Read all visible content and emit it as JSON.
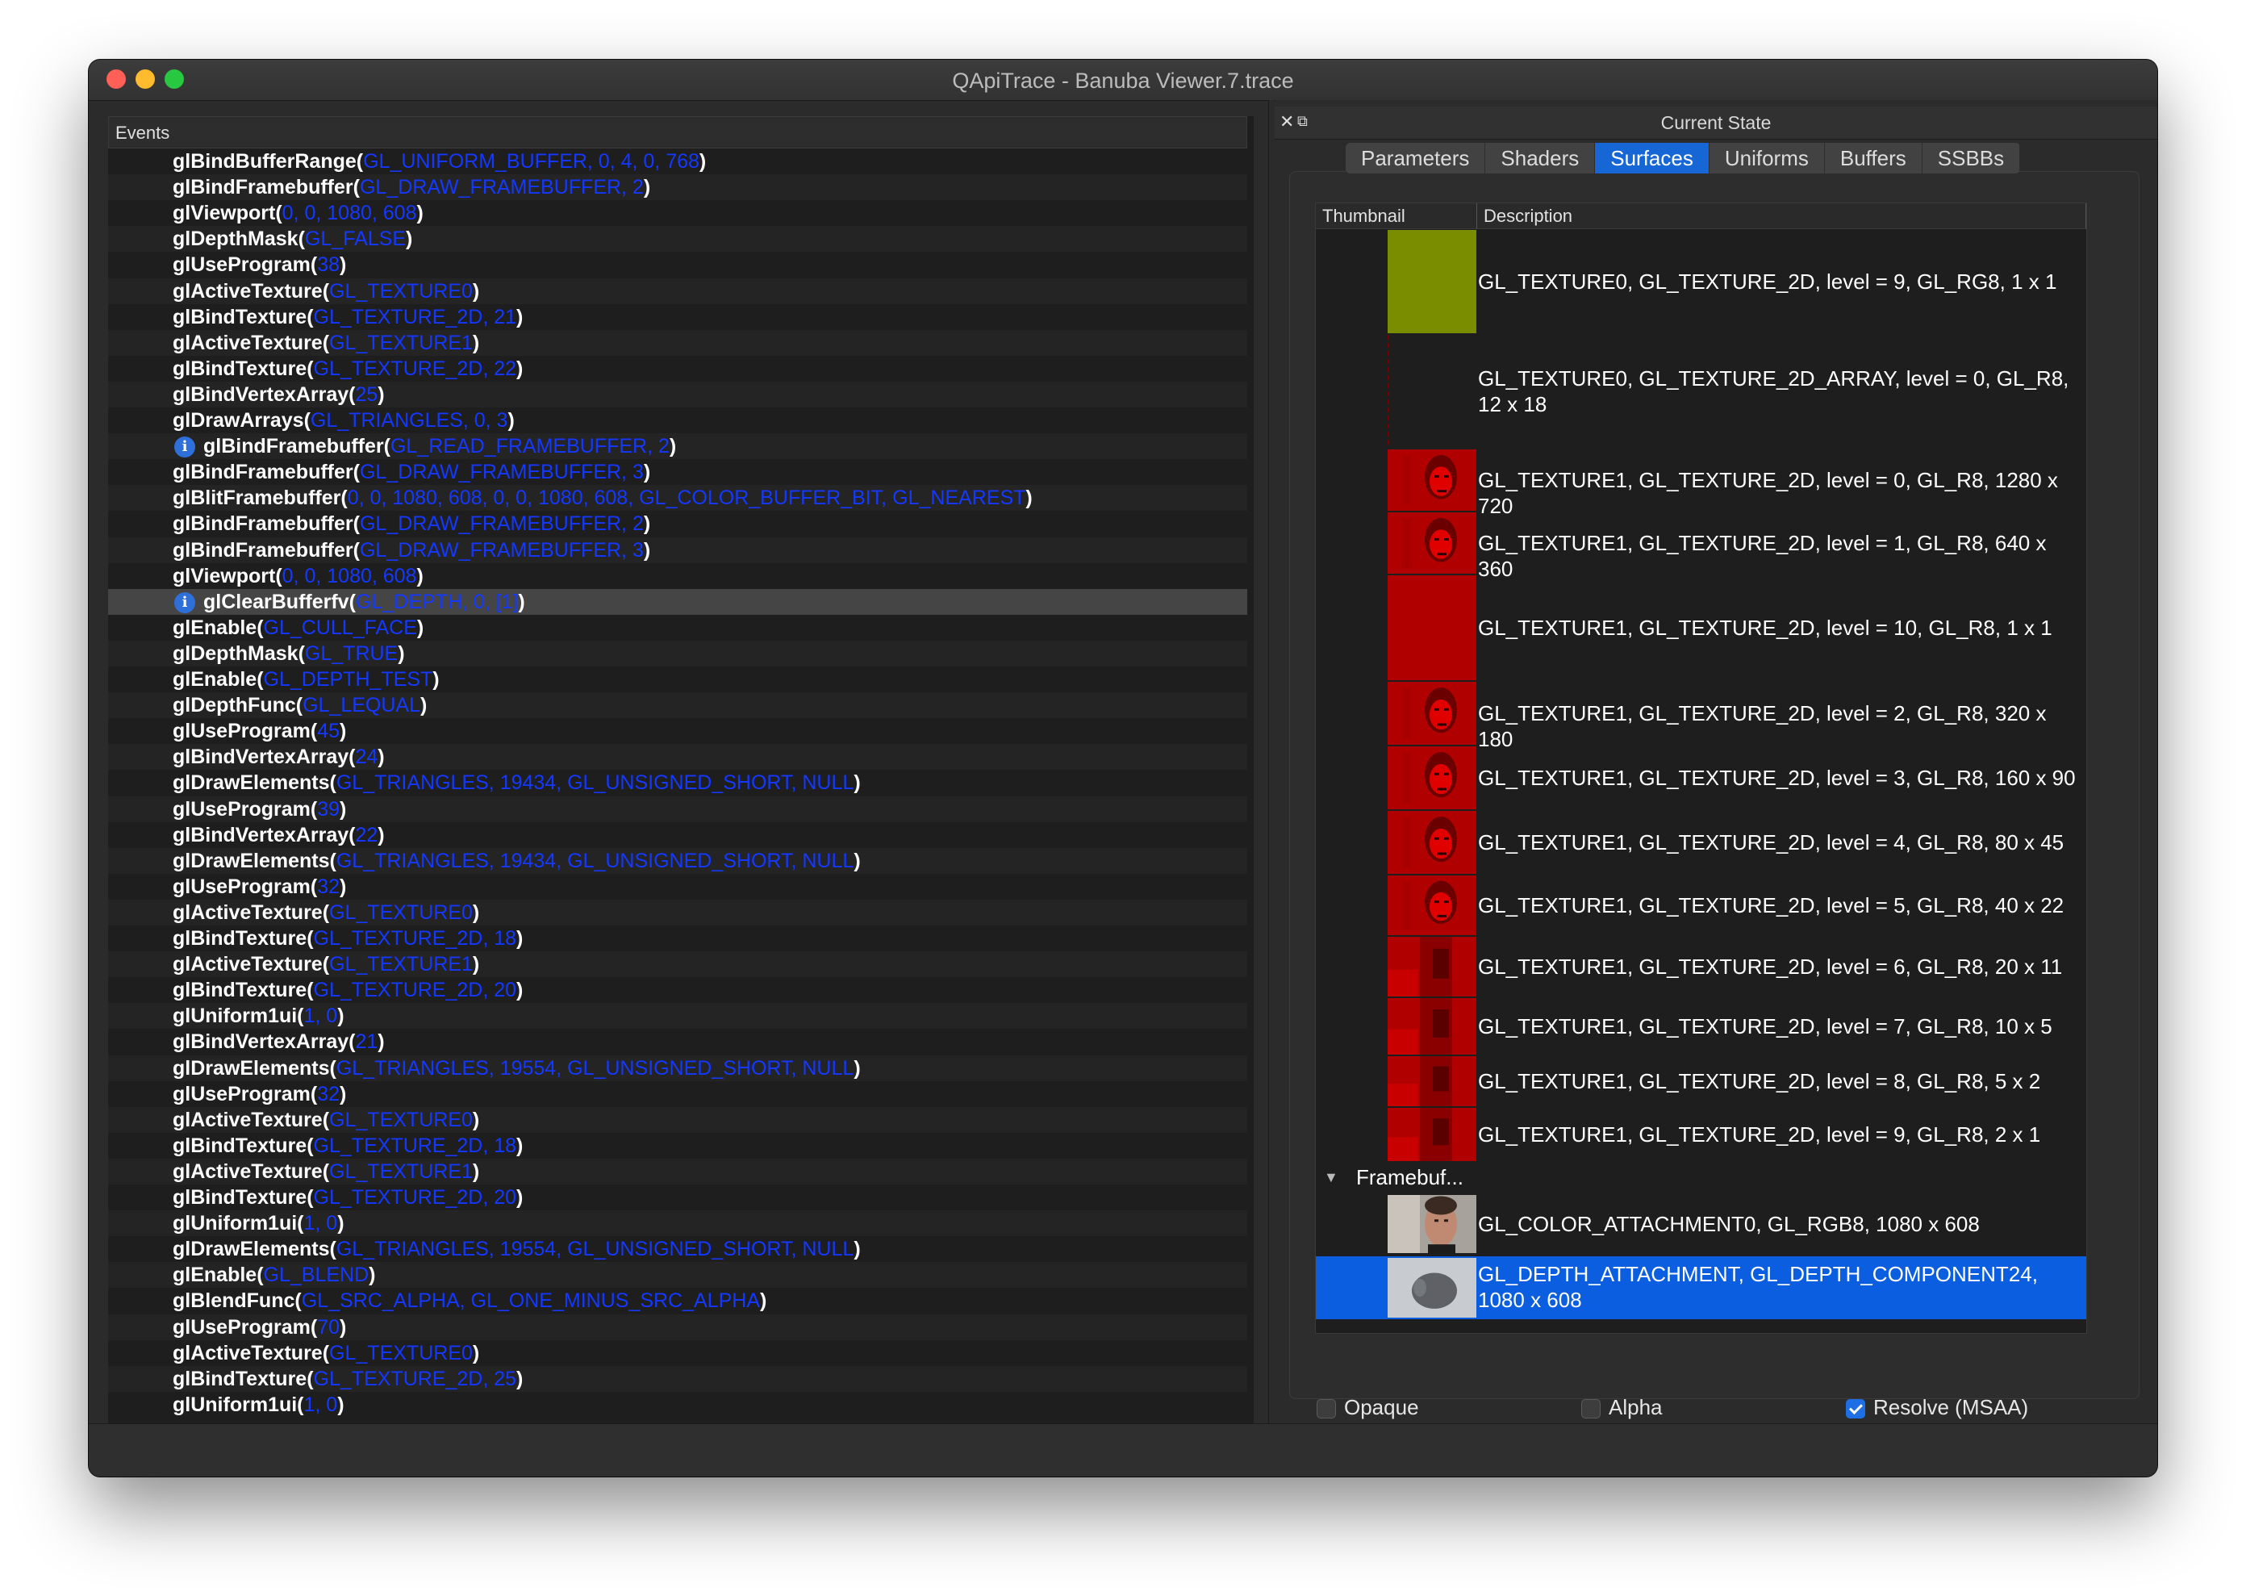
{
  "window": {
    "title": "QApiTrace - Banuba Viewer.7.trace"
  },
  "events": {
    "header": "Events",
    "rows": [
      {
        "fn": "glBindBufferRange",
        "args": "GL_UNIFORM_BUFFER, 0, 4, 0, 768",
        "info": false
      },
      {
        "fn": "glBindFramebuffer",
        "args": "GL_DRAW_FRAMEBUFFER, 2",
        "info": false
      },
      {
        "fn": "glViewport",
        "args": "0, 0, 1080, 608",
        "info": false
      },
      {
        "fn": "glDepthMask",
        "args": "GL_FALSE",
        "info": false
      },
      {
        "fn": "glUseProgram",
        "args": "38",
        "info": false
      },
      {
        "fn": "glActiveTexture",
        "args": "GL_TEXTURE0",
        "info": false
      },
      {
        "fn": "glBindTexture",
        "args": "GL_TEXTURE_2D, 21",
        "info": false
      },
      {
        "fn": "glActiveTexture",
        "args": "GL_TEXTURE1",
        "info": false
      },
      {
        "fn": "glBindTexture",
        "args": "GL_TEXTURE_2D, 22",
        "info": false
      },
      {
        "fn": "glBindVertexArray",
        "args": "25",
        "info": false
      },
      {
        "fn": "glDrawArrays",
        "args": "GL_TRIANGLES, 0, 3",
        "info": false
      },
      {
        "fn": "glBindFramebuffer",
        "args": "GL_READ_FRAMEBUFFER, 2",
        "info": true
      },
      {
        "fn": "glBindFramebuffer",
        "args": "GL_DRAW_FRAMEBUFFER, 3",
        "info": false
      },
      {
        "fn": "glBlitFramebuffer",
        "args": "0, 0, 1080, 608, 0, 0, 1080, 608, GL_COLOR_BUFFER_BIT, GL_NEAREST",
        "info": false
      },
      {
        "fn": "glBindFramebuffer",
        "args": "GL_DRAW_FRAMEBUFFER, 2",
        "info": false
      },
      {
        "fn": "glBindFramebuffer",
        "args": "GL_DRAW_FRAMEBUFFER, 3",
        "info": false
      },
      {
        "fn": "glViewport",
        "args": "0, 0, 1080, 608",
        "info": false
      },
      {
        "fn": "glClearBufferfv",
        "args": "GL_DEPTH, 0, [1]",
        "info": true,
        "selected": true
      },
      {
        "fn": "glEnable",
        "args": "GL_CULL_FACE",
        "info": false
      },
      {
        "fn": "glDepthMask",
        "args": "GL_TRUE",
        "info": false
      },
      {
        "fn": "glEnable",
        "args": "GL_DEPTH_TEST",
        "info": false
      },
      {
        "fn": "glDepthFunc",
        "args": "GL_LEQUAL",
        "info": false
      },
      {
        "fn": "glUseProgram",
        "args": "45",
        "info": false
      },
      {
        "fn": "glBindVertexArray",
        "args": "24",
        "info": false
      },
      {
        "fn": "glDrawElements",
        "args": "GL_TRIANGLES, 19434, GL_UNSIGNED_SHORT, NULL",
        "info": false
      },
      {
        "fn": "glUseProgram",
        "args": "39",
        "info": false
      },
      {
        "fn": "glBindVertexArray",
        "args": "22",
        "info": false
      },
      {
        "fn": "glDrawElements",
        "args": "GL_TRIANGLES, 19434, GL_UNSIGNED_SHORT, NULL",
        "info": false
      },
      {
        "fn": "glUseProgram",
        "args": "32",
        "info": false
      },
      {
        "fn": "glActiveTexture",
        "args": "GL_TEXTURE0",
        "info": false
      },
      {
        "fn": "glBindTexture",
        "args": "GL_TEXTURE_2D, 18",
        "info": false
      },
      {
        "fn": "glActiveTexture",
        "args": "GL_TEXTURE1",
        "info": false
      },
      {
        "fn": "glBindTexture",
        "args": "GL_TEXTURE_2D, 20",
        "info": false
      },
      {
        "fn": "glUniform1ui",
        "args": "1, 0",
        "info": false
      },
      {
        "fn": "glBindVertexArray",
        "args": "21",
        "info": false
      },
      {
        "fn": "glDrawElements",
        "args": "GL_TRIANGLES, 19554, GL_UNSIGNED_SHORT, NULL",
        "info": false
      },
      {
        "fn": "glUseProgram",
        "args": "32",
        "info": false
      },
      {
        "fn": "glActiveTexture",
        "args": "GL_TEXTURE0",
        "info": false
      },
      {
        "fn": "glBindTexture",
        "args": "GL_TEXTURE_2D, 18",
        "info": false
      },
      {
        "fn": "glActiveTexture",
        "args": "GL_TEXTURE1",
        "info": false
      },
      {
        "fn": "glBindTexture",
        "args": "GL_TEXTURE_2D, 20",
        "info": false
      },
      {
        "fn": "glUniform1ui",
        "args": "1, 0",
        "info": false
      },
      {
        "fn": "glDrawElements",
        "args": "GL_TRIANGLES, 19554, GL_UNSIGNED_SHORT, NULL",
        "info": false
      },
      {
        "fn": "glEnable",
        "args": "GL_BLEND",
        "info": false
      },
      {
        "fn": "glBlendFunc",
        "args": "GL_SRC_ALPHA, GL_ONE_MINUS_SRC_ALPHA",
        "info": false
      },
      {
        "fn": "glUseProgram",
        "args": "70",
        "info": false
      },
      {
        "fn": "glActiveTexture",
        "args": "GL_TEXTURE0",
        "info": false
      },
      {
        "fn": "glBindTexture",
        "args": "GL_TEXTURE_2D, 25",
        "info": false
      },
      {
        "fn": "glUniform1ui",
        "args": "1, 0",
        "info": false
      }
    ]
  },
  "state": {
    "title": "Current State",
    "tabs": [
      "Parameters",
      "Shaders",
      "Surfaces",
      "Uniforms",
      "Buffers",
      "SSBBs"
    ],
    "active_tab": "Surfaces",
    "columns": [
      "Thumbnail",
      "Description"
    ],
    "textures": [
      {
        "desc": "GL_TEXTURE0, GL_TEXTURE_2D, level = 9, GL_RG8, 1 x 1",
        "thumb": "olive"
      },
      {
        "desc": "GL_TEXTURE0, GL_TEXTURE_2D_ARRAY, level = 0, GL_R8, 12 x 18",
        "thumb": "thin"
      },
      {
        "desc": "GL_TEXTURE1, GL_TEXTURE_2D, level = 0, GL_R8, 1280 x 720",
        "thumb": "face-red"
      },
      {
        "desc": "GL_TEXTURE1, GL_TEXTURE_2D, level = 1, GL_R8, 640 x 360",
        "thumb": "face-red"
      },
      {
        "desc": "GL_TEXTURE1, GL_TEXTURE_2D, level = 10, GL_R8, 1 x 1",
        "thumb": "solid-red"
      },
      {
        "desc": "GL_TEXTURE1, GL_TEXTURE_2D, level = 2, GL_R8, 320 x 180",
        "thumb": "face-red"
      },
      {
        "desc": "GL_TEXTURE1, GL_TEXTURE_2D, level = 3, GL_R8, 160 x 90",
        "thumb": "face-red"
      },
      {
        "desc": "GL_TEXTURE1, GL_TEXTURE_2D, level = 4, GL_R8, 80 x 45",
        "thumb": "face-red"
      },
      {
        "desc": "GL_TEXTURE1, GL_TEXTURE_2D, level = 5, GL_R8, 40 x 22",
        "thumb": "face-red"
      },
      {
        "desc": "GL_TEXTURE1, GL_TEXTURE_2D, level = 6, GL_R8, 20 x 11",
        "thumb": "pixel-red"
      },
      {
        "desc": "GL_TEXTURE1, GL_TEXTURE_2D, level = 7, GL_R8, 10 x 5",
        "thumb": "pixel-red"
      },
      {
        "desc": "GL_TEXTURE1, GL_TEXTURE_2D, level = 8, GL_R8, 5 x 2",
        "thumb": "pixel-red"
      },
      {
        "desc": "GL_TEXTURE1, GL_TEXTURE_2D, level = 9, GL_R8, 2 x 1",
        "thumb": "pixel-red"
      }
    ],
    "framebuffer_label": "Framebuf...",
    "attachments": [
      {
        "desc": "GL_COLOR_ATTACHMENT0, GL_RGB8, 1080 x 608",
        "thumb": "photo",
        "selected": false
      },
      {
        "desc": "GL_DEPTH_ATTACHMENT, GL_DEPTH_COMPONENT24, 1080 x 608",
        "thumb": "depth",
        "selected": true
      }
    ],
    "checkboxes": [
      {
        "label": "Opaque",
        "checked": false
      },
      {
        "label": "Alpha",
        "checked": false
      },
      {
        "label": "Resolve (MSAA)",
        "checked": true
      }
    ]
  },
  "colors": {
    "arg_blue": "#1438ff",
    "selection": "#0c5ee0",
    "texture_red": "#b30000",
    "olive": "#7a8c00"
  }
}
